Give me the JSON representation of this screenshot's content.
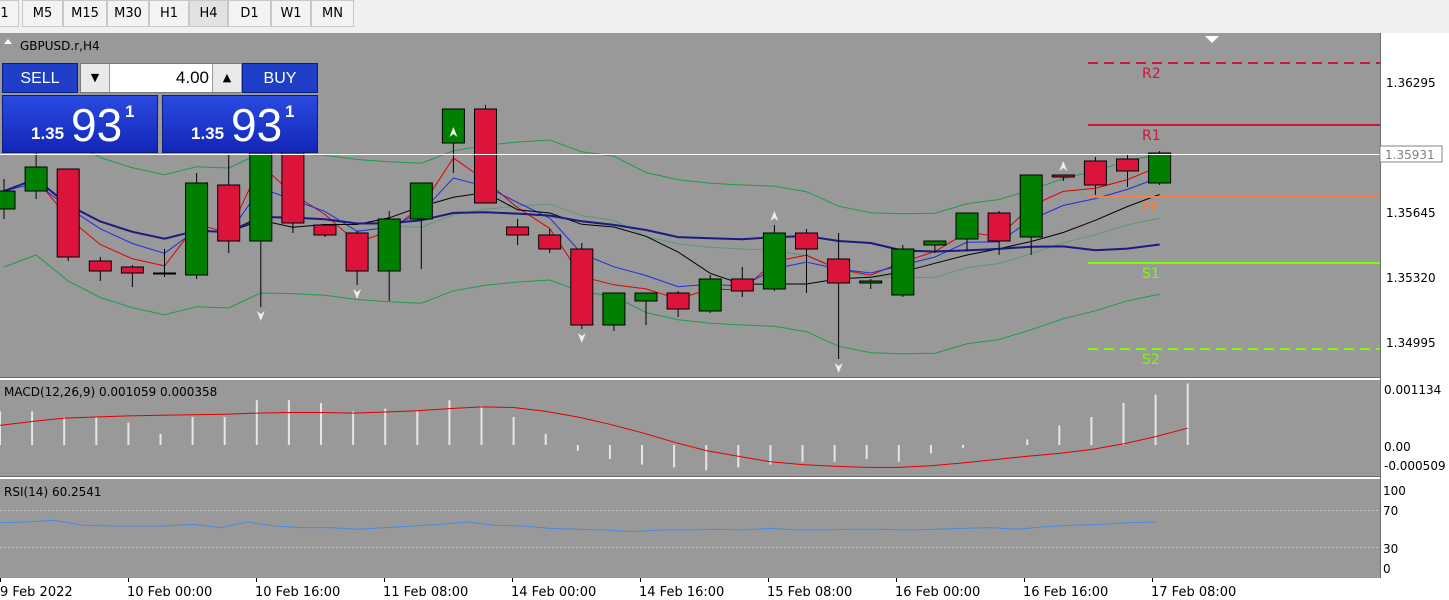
{
  "timeframes": [
    {
      "label": "1",
      "active": false
    },
    {
      "label": "M5",
      "active": false
    },
    {
      "label": "M15",
      "active": false
    },
    {
      "label": "M30",
      "active": false
    },
    {
      "label": "H1",
      "active": false
    },
    {
      "label": "H4",
      "active": true
    },
    {
      "label": "D1",
      "active": false
    },
    {
      "label": "W1",
      "active": false
    },
    {
      "label": "MN",
      "active": false
    }
  ],
  "symbol_title": "GBPUSD.r,H4",
  "trade_panel": {
    "sell_label": "SELL",
    "buy_label": "BUY",
    "lot": "4.00",
    "sell_price": {
      "prefix": "1.35",
      "big": "93",
      "sup": "1"
    },
    "buy_price": {
      "prefix": "1.35",
      "big": "93",
      "sup": "1"
    }
  },
  "colors": {
    "background": "#999999",
    "bull": "#008000",
    "bear": "#dc143c",
    "resistance": "#c8183c",
    "pivot": "#f08050",
    "support": "#7cfc00",
    "macd_signal": "#e00000",
    "rsi_line": "#4a8ae0"
  },
  "current_price": "1.35931",
  "chart_data": {
    "type": "candlestick",
    "price_ticks": [
      "1.36295",
      "1.35645",
      "1.35320",
      "1.34995"
    ],
    "time_labels": [
      "9 Feb 2022",
      "10 Feb 00:00",
      "10 Feb 16:00",
      "11 Feb 08:00",
      "14 Feb 00:00",
      "14 Feb 16:00",
      "15 Feb 08:00",
      "16 Feb 00:00",
      "16 Feb 16:00",
      "17 Feb 08:00"
    ],
    "candles": [
      [
        1.3566,
        1.3581,
        1.3561,
        1.3575
      ],
      [
        1.3575,
        1.3596,
        1.3571,
        1.3587
      ],
      [
        1.3586,
        1.3586,
        1.354,
        1.3542
      ],
      [
        1.354,
        1.3542,
        1.353,
        1.3535
      ],
      [
        1.3537,
        1.3538,
        1.3527,
        1.3534
      ],
      [
        1.3534,
        1.3546,
        1.3532,
        1.3534
      ],
      [
        1.3533,
        1.3584,
        1.3531,
        1.3579
      ],
      [
        1.3578,
        1.3593,
        1.3544,
        1.355
      ],
      [
        1.355,
        1.3622,
        1.3517,
        1.3622
      ],
      [
        1.3605,
        1.3605,
        1.3554,
        1.3559
      ],
      [
        1.3558,
        1.3558,
        1.3552,
        1.3553
      ],
      [
        1.3554,
        1.3555,
        1.3528,
        1.3535
      ],
      [
        1.3535,
        1.3565,
        1.352,
        1.3561
      ],
      [
        1.3561,
        1.3576,
        1.3536,
        1.3579
      ],
      [
        1.3599,
        1.36,
        1.3584,
        1.3616
      ],
      [
        1.3616,
        1.3618,
        1.357,
        1.3569
      ],
      [
        1.3557,
        1.3561,
        1.3548,
        1.3553
      ],
      [
        1.3553,
        1.3556,
        1.3544,
        1.3546
      ],
      [
        1.3546,
        1.3549,
        1.3506,
        1.3508
      ],
      [
        1.3508,
        1.3524,
        1.3505,
        1.3524
      ],
      [
        1.352,
        1.3524,
        1.3508,
        1.3524
      ],
      [
        1.3524,
        1.3525,
        1.3512,
        1.3516
      ],
      [
        1.3515,
        1.3533,
        1.3514,
        1.3531
      ],
      [
        1.3531,
        1.3537,
        1.3522,
        1.3525
      ],
      [
        1.3526,
        1.3558,
        1.3525,
        1.3554
      ],
      [
        1.3554,
        1.3556,
        1.3524,
        1.3546
      ],
      [
        1.3541,
        1.3554,
        1.3491,
        1.3529
      ],
      [
        1.3529,
        1.3531,
        1.3526,
        1.353
      ],
      [
        1.3523,
        1.3548,
        1.3522,
        1.3546
      ],
      [
        1.3548,
        1.355,
        1.3544,
        1.355
      ],
      [
        1.3551,
        1.3564,
        1.3545,
        1.3564
      ],
      [
        1.3564,
        1.3565,
        1.3543,
        1.355
      ],
      [
        1.3552,
        1.3583,
        1.3543,
        1.3583
      ],
      [
        1.3583,
        1.3583,
        1.358,
        1.3582
      ],
      [
        1.359,
        1.3592,
        1.3573,
        1.3578
      ],
      [
        1.3591,
        1.3593,
        1.3577,
        1.3585
      ],
      [
        1.3579,
        1.3595,
        1.3578,
        1.3594
      ]
    ],
    "pivots": {
      "R2": 1.3639,
      "R1": 1.3608,
      "PP": 1.3572,
      "S1": 1.3539,
      "S2": 1.3496
    },
    "macd": {
      "title": "MACD(12,26,9) 0.001059 0.000358",
      "ticks": [
        "0.001134",
        "0.00",
        "-0.000509"
      ],
      "hist": [
        0.0006,
        0.0006,
        0.0005,
        0.0005,
        0.0004,
        0.0002,
        0.0005,
        0.0005,
        0.0008,
        0.0008,
        0.00075,
        0.0006,
        0.00065,
        0.0006,
        0.0008,
        0.0007,
        0.0005,
        0.0002,
        -0.0001,
        -0.00025,
        -0.00035,
        -0.0004,
        -0.00045,
        -0.0004,
        -0.00035,
        -0.0003,
        -0.0003,
        -0.00025,
        -0.0003,
        -0.00015,
        -5e-05,
        0.0,
        0.0001,
        0.00035,
        0.0005,
        0.00075,
        0.0009,
        0.0011
      ],
      "signal": [
        0.00035,
        0.00042,
        0.00048,
        0.0005,
        0.00052,
        0.00053,
        0.00054,
        0.00055,
        0.00057,
        0.00058,
        0.00058,
        0.00057,
        0.00059,
        0.00061,
        0.00065,
        0.00068,
        0.00067,
        0.0006,
        0.0005,
        0.00037,
        0.00022,
        5e-05,
        -0.0001,
        -0.0002,
        -0.0003,
        -0.00035,
        -0.00038,
        -0.0004,
        -0.0004,
        -0.00037,
        -0.00032,
        -0.00026,
        -0.0002,
        -0.00015,
        -8e-05,
        2e-05,
        0.00015,
        0.0003
      ]
    },
    "rsi": {
      "title": "RSI(14) 60.2541",
      "ticks": [
        "100",
        "70",
        "30",
        "0"
      ],
      "values": [
        59,
        60,
        62,
        56,
        55,
        55,
        55,
        57,
        53,
        60,
        55,
        53,
        53,
        51,
        53,
        55,
        57,
        60,
        56,
        55,
        52,
        51,
        50,
        48,
        50,
        50,
        51,
        50,
        52,
        50,
        50,
        51,
        51,
        50,
        51,
        52,
        53,
        51,
        54,
        56,
        57,
        59,
        60
      ]
    }
  }
}
